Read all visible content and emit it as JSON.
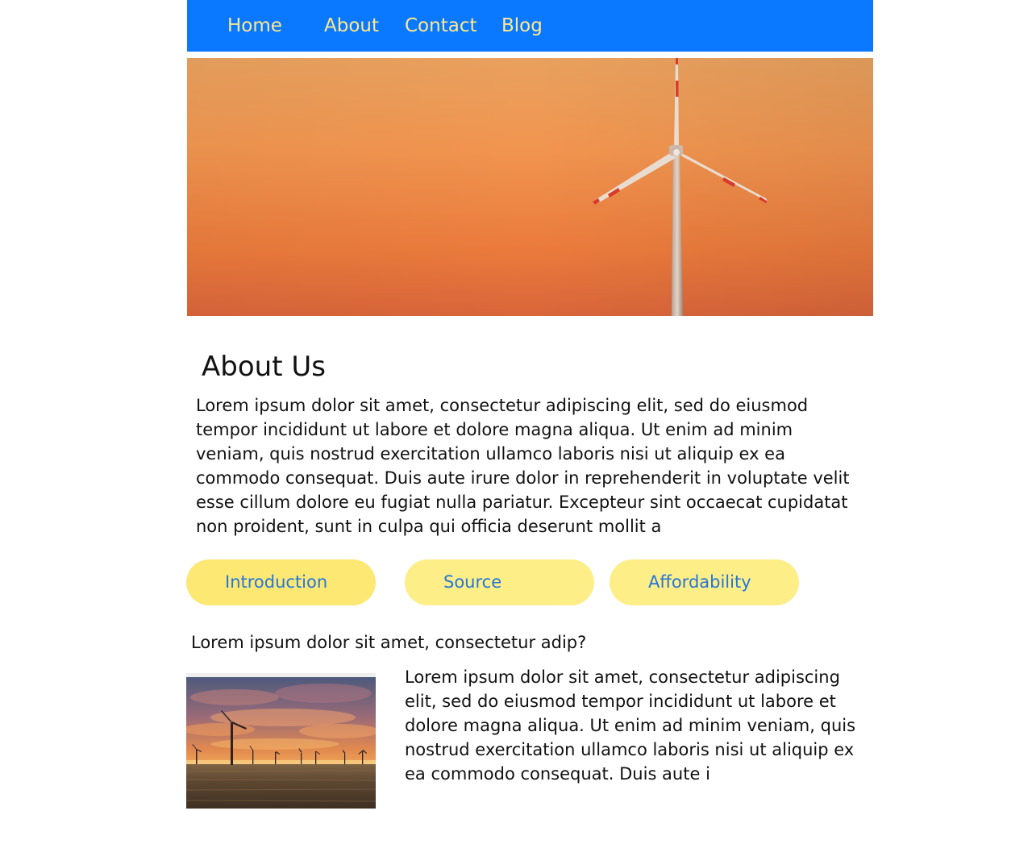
{
  "nav": {
    "items": [
      {
        "label": "Home"
      },
      {
        "label": "About"
      },
      {
        "label": "Contact"
      },
      {
        "label": "Blog"
      }
    ]
  },
  "colors": {
    "nav_background": "#0a78ff",
    "nav_text": "#ffe98a",
    "pill_background": "#fdee88",
    "pill_text": "#2676d8"
  },
  "hero": {
    "image": "wind-turbine-sunset-image"
  },
  "about": {
    "title": "About Us",
    "body": "Lorem ipsum dolor sit amet, consectetur adipiscing elit, sed do eiusmod tempor incididunt ut labore et dolore magna aliqua. Ut enim ad minim veniam, quis nostrud exercitation ullamco laboris nisi ut aliquip ex ea commodo consequat. Duis aute irure dolor in reprehenderit in voluptate velit esse cillum dolore eu fugiat nulla pariatur. Excepteur sint occaecat cupidatat non proident, sunt in culpa qui officia deserunt mollit a"
  },
  "tabs": [
    {
      "label": "Introduction"
    },
    {
      "label": "Source"
    },
    {
      "label": "Affordability"
    }
  ],
  "section": {
    "question": "Lorem ipsum dolor sit amet, consectetur adip?",
    "thumbnail": "wind-farm-sunset-image",
    "body": "Lorem ipsum dolor sit amet, consectetur adipiscing elit, sed do eiusmod tempor incididunt ut labore et dolore magna aliqua. Ut enim ad minim veniam, quis nostrud exercitation ullamco laboris nisi ut aliquip ex ea commodo consequat. Duis aute i"
  }
}
